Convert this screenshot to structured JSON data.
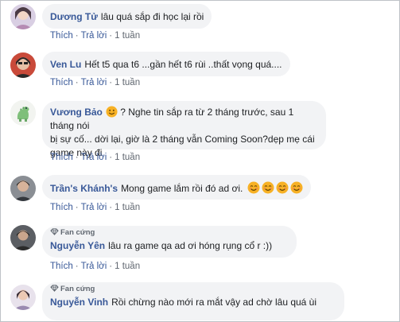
{
  "actions": {
    "like_label": "Thích",
    "reply_label": "Trả lời",
    "separator": "·"
  },
  "badge_label": "Fan cứng",
  "comments": [
    {
      "author": "Dương Tử",
      "text": "lâu quá sắp đi học lại rồi",
      "time": "1 tuần",
      "avatar_icon": "avatar-photo",
      "badge": false
    },
    {
      "author": "Ven Lu",
      "text": "Hết t5 qua t6 ...gần hết t6 rùi ..thất vọng quá....",
      "time": "1 tuần",
      "avatar_icon": "avatar-photo",
      "badge": false
    },
    {
      "author": "Vương Bảo",
      "text_line1": "? Nghe tin sắp ra từ 2 tháng trước, sau 1 tháng nói",
      "text_line2": "bị sự cố... dời lại, giờ là 2 tháng vẫn Coming Soon?dẹp mẹ cái",
      "text_line3": "game này đi",
      "time": "1 tuần",
      "avatar_icon": "dinosaur-avatar",
      "badge": false
    },
    {
      "author": "Trần's Khánh's",
      "text": "Mong game lắm rồi đó ad ơi.",
      "time": "1 tuần",
      "avatar_icon": "avatar-photo",
      "badge": false
    },
    {
      "author": "Nguyễn Yên",
      "text": "lâu ra game qa ad ơi hóng rụng cổ r :))",
      "time": "1 tuần",
      "avatar_icon": "avatar-photo",
      "badge": true
    },
    {
      "author": "Nguyễn Vinh",
      "text": "Rồi chừng nào mới ra mắt vậy ad chờ lâu quá ùi",
      "avatar_icon": "avatar-photo",
      "badge": true
    }
  ],
  "colors": {
    "link": "#385898",
    "bubble": "#f2f3f5",
    "meta": "#606770",
    "emoji": "#f7b125"
  }
}
